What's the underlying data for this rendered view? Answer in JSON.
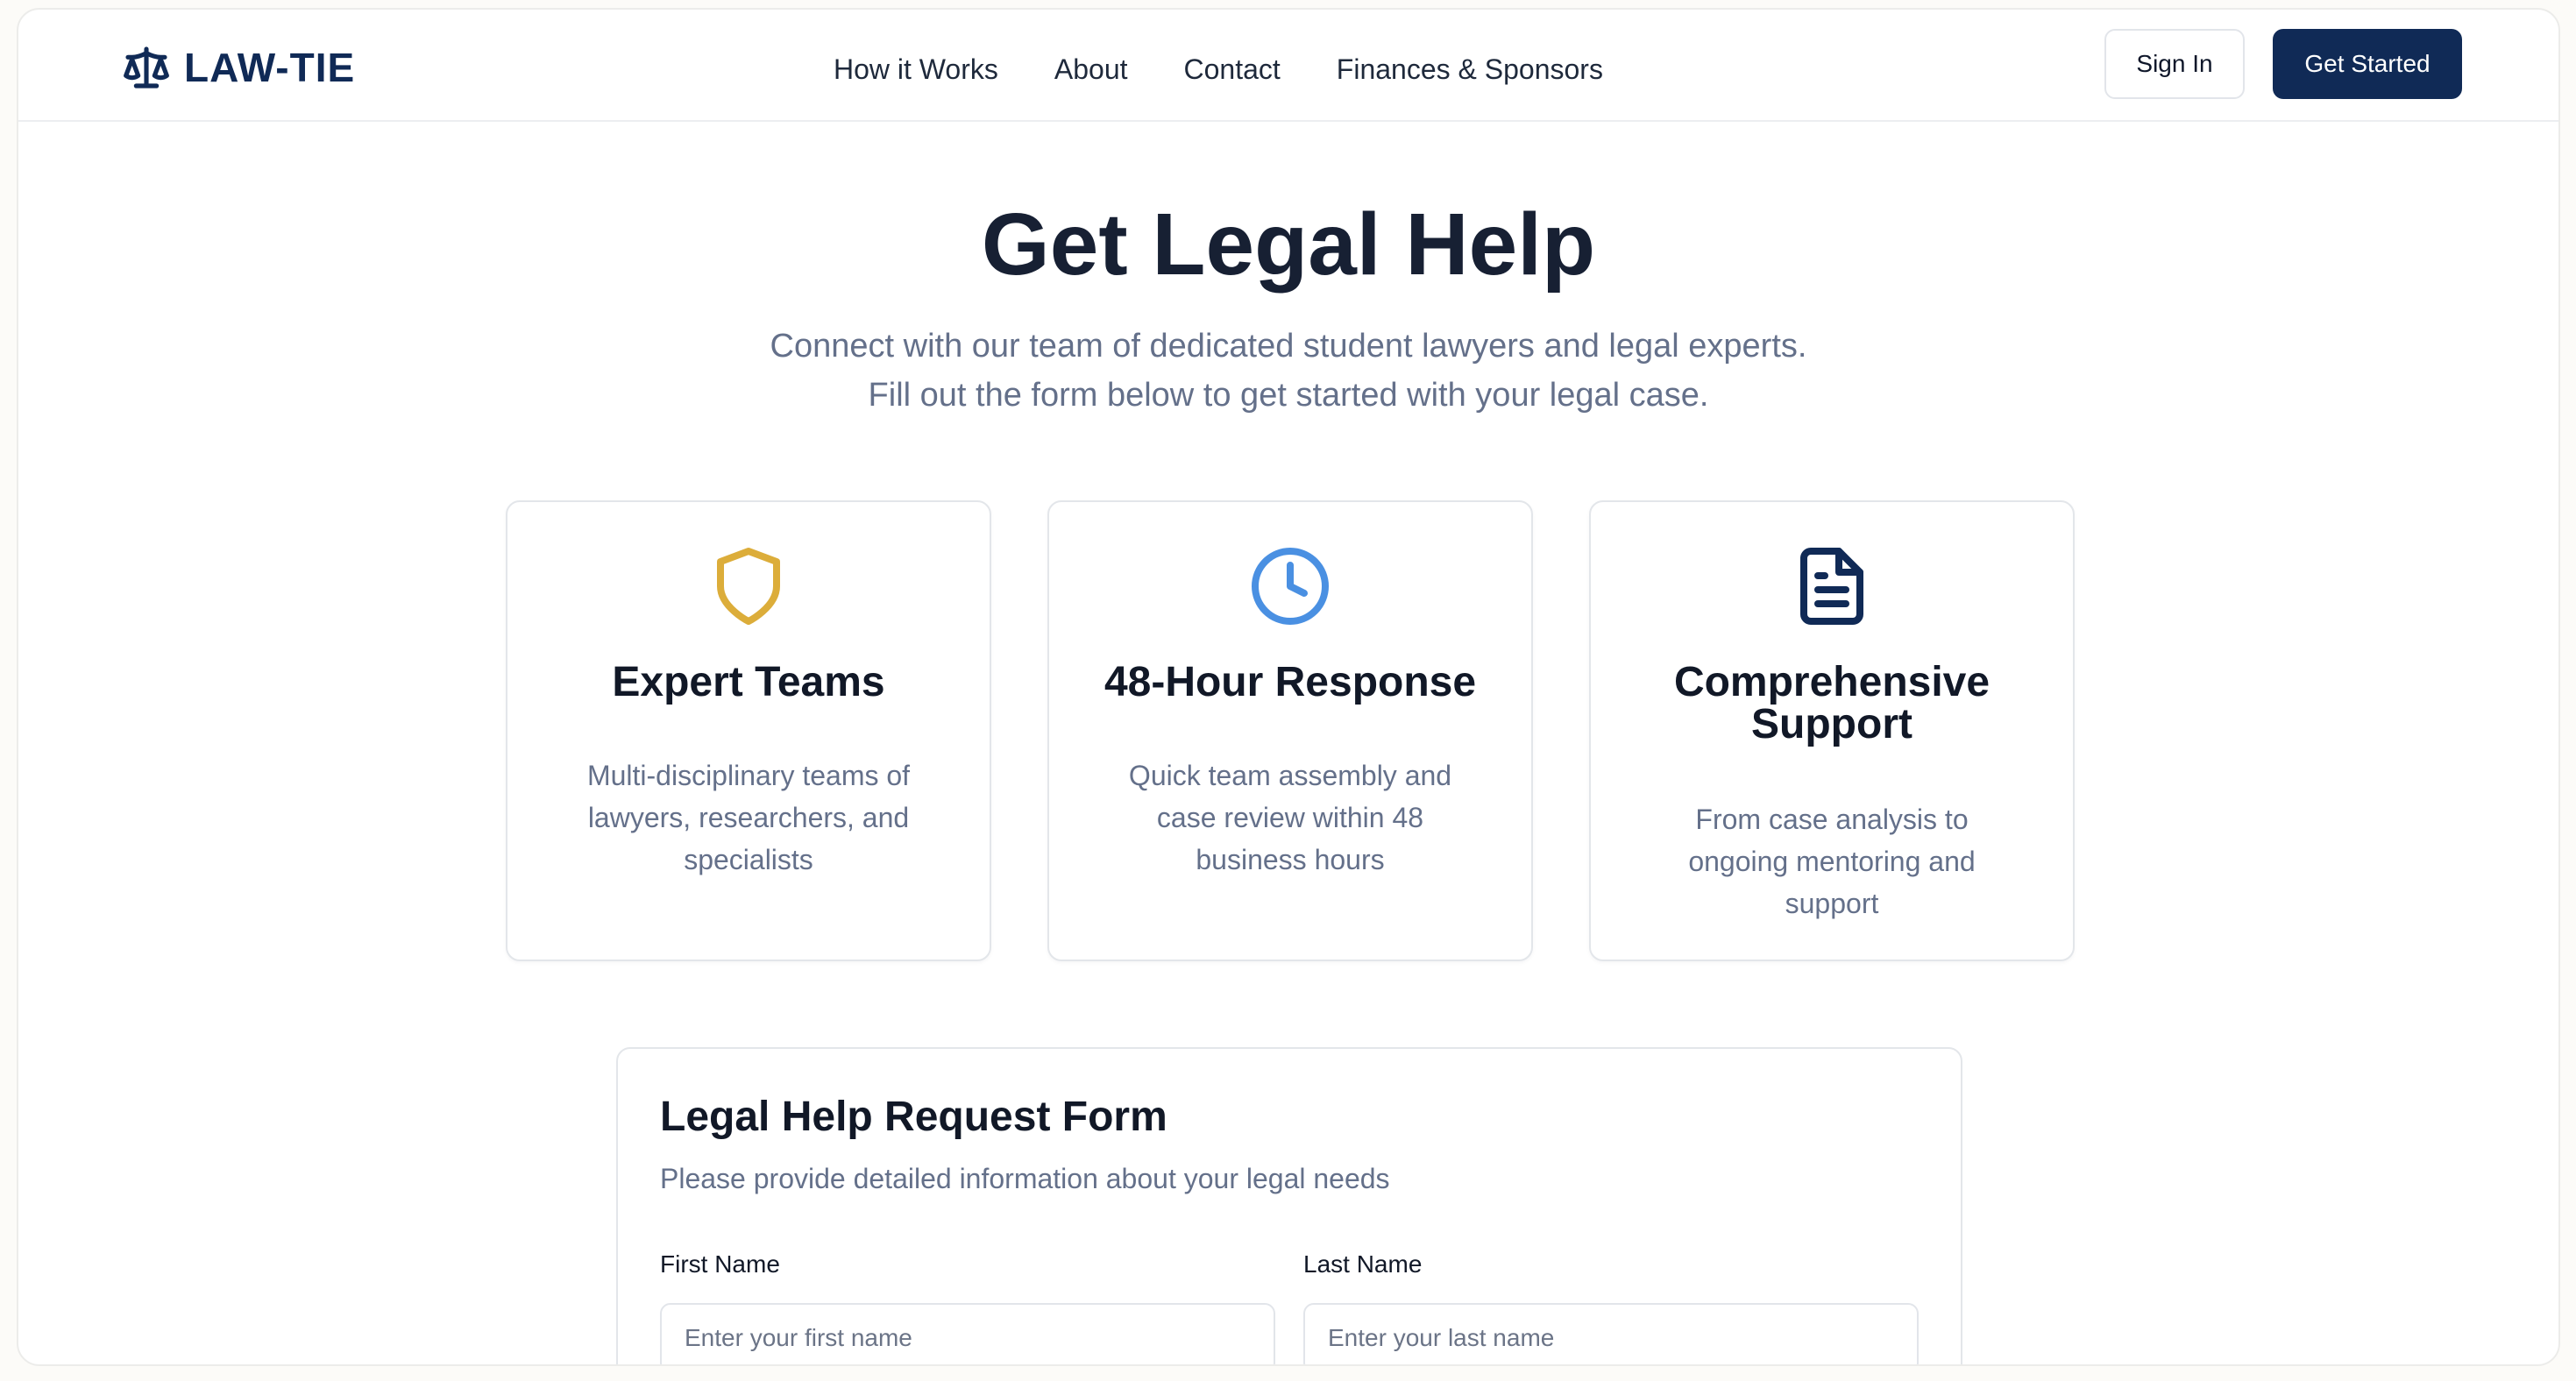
{
  "header": {
    "logo_text": "LAW-TIE",
    "nav": [
      "How it Works",
      "About",
      "Contact",
      "Finances & Sponsors"
    ],
    "sign_in_label": "Sign In",
    "get_started_label": "Get Started"
  },
  "hero": {
    "title": "Get Legal Help",
    "subtitle_line1": "Connect with our team of dedicated student lawyers and legal experts.",
    "subtitle_line2": "Fill out the form below to get started with your legal case."
  },
  "features": [
    {
      "icon": "shield-icon",
      "title": "Expert Teams",
      "description": "Multi-disciplinary teams of lawyers, researchers, and specialists"
    },
    {
      "icon": "clock-icon",
      "title": "48-Hour Response",
      "description": "Quick team assembly and case review within 48 business hours"
    },
    {
      "icon": "document-icon",
      "title": "Comprehensive Support",
      "description": "From case analysis to ongoing mentoring and support"
    }
  ],
  "form": {
    "title": "Legal Help Request Form",
    "subtitle": "Please provide detailed information about your legal needs",
    "first_name_label": "First Name",
    "first_name_placeholder": "Enter your first name",
    "first_name_value": "",
    "last_name_label": "Last Name",
    "last_name_placeholder": "Enter your last name",
    "last_name_value": ""
  },
  "colors": {
    "brand_navy": "#102a56",
    "shield_gold": "#dcad3a",
    "clock_blue": "#4a90e2",
    "document_navy": "#102a56",
    "muted_text": "#64708a"
  }
}
